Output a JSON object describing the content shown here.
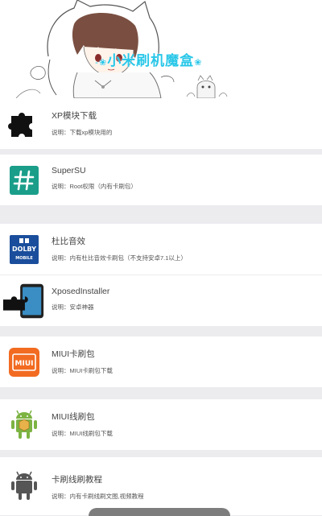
{
  "header": {
    "title": "小米刷机魔盒",
    "deco_left": "-❀",
    "deco_right": "❀"
  },
  "items": [
    {
      "title": "XP模块下载",
      "desc": "说明：下载xp模块用的",
      "icon": "puzzle-icon"
    },
    {
      "title": "SuperSU",
      "desc": "说明：Root权限（内有卡刷包）",
      "icon": "supersu-hash-icon"
    },
    {
      "title": "杜比音效",
      "desc": "说明：内有杜比音效卡刷包（不支持安卓7.1以上）",
      "icon": "dolby-mobile-icon",
      "icon_text_1": "DOLBY",
      "icon_text_2": "MOBILE"
    },
    {
      "title": "XposedInstaller",
      "desc": "说明：安卓神器",
      "icon": "xposed-icon"
    },
    {
      "title": "MIUI卡刷包",
      "desc": "说明：MIUI卡刷包下载",
      "icon": "miui-icon",
      "icon_text": "MIUI"
    },
    {
      "title": "MIUI线刷包",
      "desc": "说明：MIUI线刷包下载",
      "icon": "android-box-icon"
    },
    {
      "title": "卡刷线刷教程",
      "desc": "说明：内有卡刷线刷文图,视频教程",
      "icon": "android-robot-icon"
    }
  ],
  "colors": {
    "accent": "#29c7e8",
    "supersu": "#1a9e8a",
    "dolby": "#1a4e9c",
    "miui": "#f26b21",
    "android_green": "#7cb342",
    "android_gray": "#555555"
  }
}
